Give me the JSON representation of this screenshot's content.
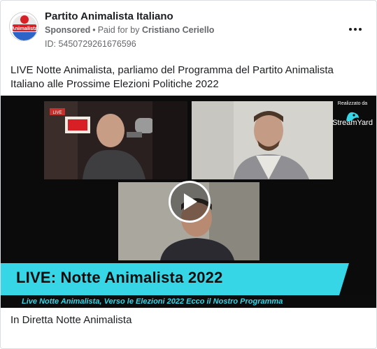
{
  "advertiser": {
    "name": "Partito Animalista Italiano",
    "avatar_text": "Animalista"
  },
  "meta": {
    "sponsored": "Sponsored",
    "separator": "•",
    "paid_for_prefix": "Paid for by",
    "payer": "Cristiano Ceriello",
    "ad_id": "ID: 5450729261676596"
  },
  "post_text": "LIVE Notte Animalista, parliamo del Programma del Partito Animalista Italiano alle Prossime Elezioni Politiche 2022",
  "video": {
    "brand_top": "Realizzato da",
    "brand_name": "StreamYard",
    "studio_sign": "LIVE",
    "banner_title": "LIVE: Notte Animalista 2022",
    "subtitle": "Live Notte Animalista, Verso le Elezioni 2022 Ecco il Nostro Programma",
    "accent_color": "#36d6e7"
  },
  "footer": {
    "title": "In Diretta Notte Animalista"
  },
  "icons": {
    "more": "more-options-icon",
    "play": "play-icon"
  }
}
